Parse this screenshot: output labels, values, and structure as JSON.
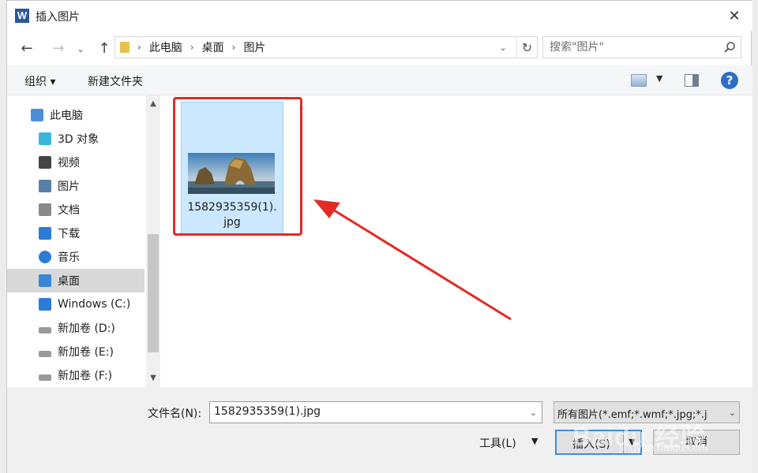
{
  "app": {
    "icon_letter": "W",
    "title": "插入图片"
  },
  "address": {
    "crumbs": [
      "此电脑",
      "桌面",
      "图片"
    ]
  },
  "search": {
    "placeholder": "搜索\"图片\""
  },
  "toolbar": {
    "organize": "组织 ▾",
    "new_folder": "新建文件夹",
    "help": "?"
  },
  "nav": {
    "items": [
      {
        "label": "此电脑",
        "icon": "computer-icon"
      },
      {
        "label": "3D 对象",
        "icon": "cube-icon"
      },
      {
        "label": "视频",
        "icon": "video-icon"
      },
      {
        "label": "图片",
        "icon": "picture-icon"
      },
      {
        "label": "文档",
        "icon": "document-icon"
      },
      {
        "label": "下载",
        "icon": "download-icon"
      },
      {
        "label": "音乐",
        "icon": "music-icon"
      },
      {
        "label": "桌面",
        "icon": "desktop-icon"
      },
      {
        "label": "Windows (C:)",
        "icon": "windows-drive-icon"
      },
      {
        "label": "新加卷 (D:)",
        "icon": "drive-icon"
      },
      {
        "label": "新加卷 (E:)",
        "icon": "drive-icon"
      },
      {
        "label": "新加卷 (F:)",
        "icon": "drive-icon"
      }
    ],
    "selected": "桌面"
  },
  "file": {
    "name_line1": "1582935359(1).",
    "name_line2": "jpg"
  },
  "bottom": {
    "filename_label": "文件名(N):",
    "filename_value": "1582935359(1).jpg",
    "filetype_value": "所有图片(*.emf;*.wmf;*.jpg;*.j",
    "tools": "工具(L)",
    "insert": "插入(S)",
    "cancel": "取消"
  },
  "watermark": {
    "main": "Baidu 经验",
    "sub": "jingyan.baidu.com"
  },
  "colors": {
    "highlight": "#e22b25",
    "selection": "#cce8ff",
    "accent": "#2a6fc9"
  }
}
